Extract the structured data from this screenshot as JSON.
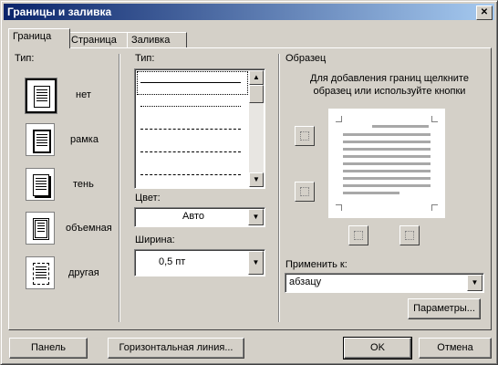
{
  "window": {
    "title": "Границы и заливка",
    "close_glyph": "✕"
  },
  "tabs": [
    {
      "label": "Граница",
      "active": true
    },
    {
      "label": "Страница",
      "active": false
    },
    {
      "label": "Заливка",
      "active": false
    }
  ],
  "type_section": {
    "label": "Тип:",
    "presets": [
      {
        "label": "нет",
        "icon": "border-none-icon"
      },
      {
        "label": "рамка",
        "icon": "border-box-icon"
      },
      {
        "label": "тень",
        "icon": "border-shadow-icon"
      },
      {
        "label": "объемная",
        "icon": "border-3d-icon"
      },
      {
        "label": "другая",
        "icon": "border-custom-icon"
      }
    ]
  },
  "style_section": {
    "label": "Тип:",
    "line_styles": [
      "solid",
      "dotted",
      "dashed-small",
      "dashed-large",
      "dash-dot"
    ],
    "color_label": "Цвет:",
    "color_value": "Авто",
    "width_label": "Ширина:",
    "width_value": "0,5 пт"
  },
  "preview_section": {
    "label": "Образец",
    "hint": "Для добавления границ щелкните образец или используйте кнопки",
    "apply_label": "Применить к:",
    "apply_value": "абзацу",
    "options_button": "Параметры..."
  },
  "footer": {
    "panel_button": "Панель",
    "hline_button": "Горизонтальная линия...",
    "ok_button": "OK",
    "cancel_button": "Отмена"
  }
}
